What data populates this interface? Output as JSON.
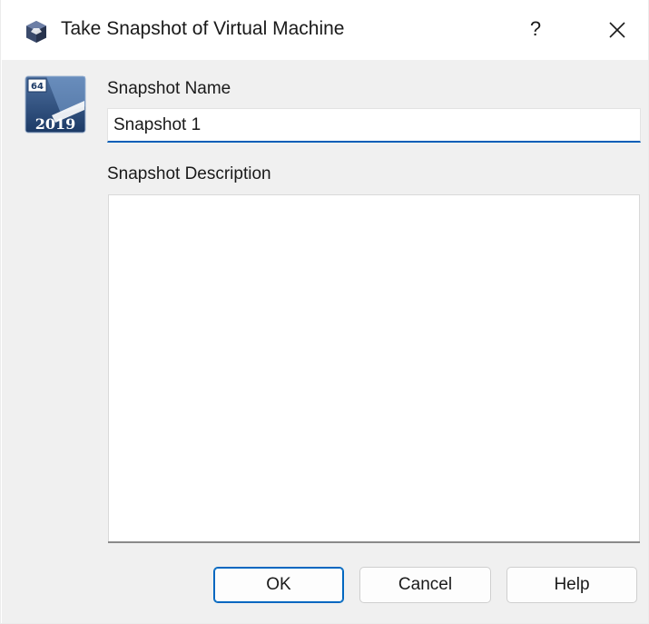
{
  "window": {
    "title": "Take Snapshot of Virtual Machine",
    "help_glyph": "?",
    "app_icon": "virtualbox-cube-icon",
    "close_icon": "close-icon"
  },
  "os_badge": {
    "icon": "windows-server-2019-64bit-icon",
    "arch": "64",
    "version": "2019"
  },
  "form": {
    "name_label": "Snapshot Name",
    "name_value": "Snapshot 1",
    "description_label": "Snapshot Description",
    "description_value": ""
  },
  "buttons": {
    "ok": "OK",
    "cancel": "Cancel",
    "help": "Help"
  },
  "colors": {
    "accent": "#005fb8",
    "client_bg": "#f0f0f0",
    "badge_blue": "#1f4e8c"
  }
}
